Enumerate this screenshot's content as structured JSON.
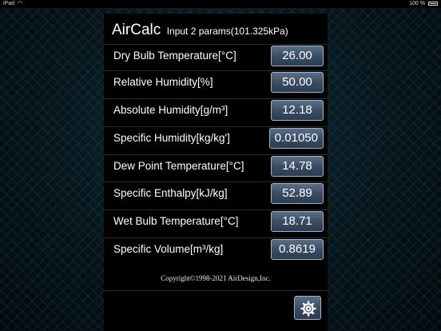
{
  "status_bar": {
    "carrier": "iPad",
    "battery": "100 %"
  },
  "header": {
    "title": "AirCalc",
    "subtitle": "Input 2 params(101.325kPa)"
  },
  "rows": [
    {
      "label": "Dry Bulb Temperature[°C]",
      "value": "26.00"
    },
    {
      "label": "Relative Humidity[%]",
      "value": "50.00"
    },
    {
      "label": "Absolute Humidity[g/m³]",
      "value": "12.18"
    },
    {
      "label": "Specific Humidity[kg/kg']",
      "value": "0.01050"
    },
    {
      "label": "Dew Point Temperature[°C]",
      "value": "14.78"
    },
    {
      "label": "Specific Enthalpy[kJ/kg]",
      "value": "52.89"
    },
    {
      "label": "Wet Bulb Temperature[°C]",
      "value": "18.71"
    },
    {
      "label": "Specific Volume[m³/kg]",
      "value": "0.8619"
    }
  ],
  "footer": {
    "copyright": "Copyright©1998-2021 AirDesign,Inc."
  },
  "icons": {
    "settings": "gear-icon",
    "wifi": "wifi-icon",
    "battery": "battery-icon"
  }
}
